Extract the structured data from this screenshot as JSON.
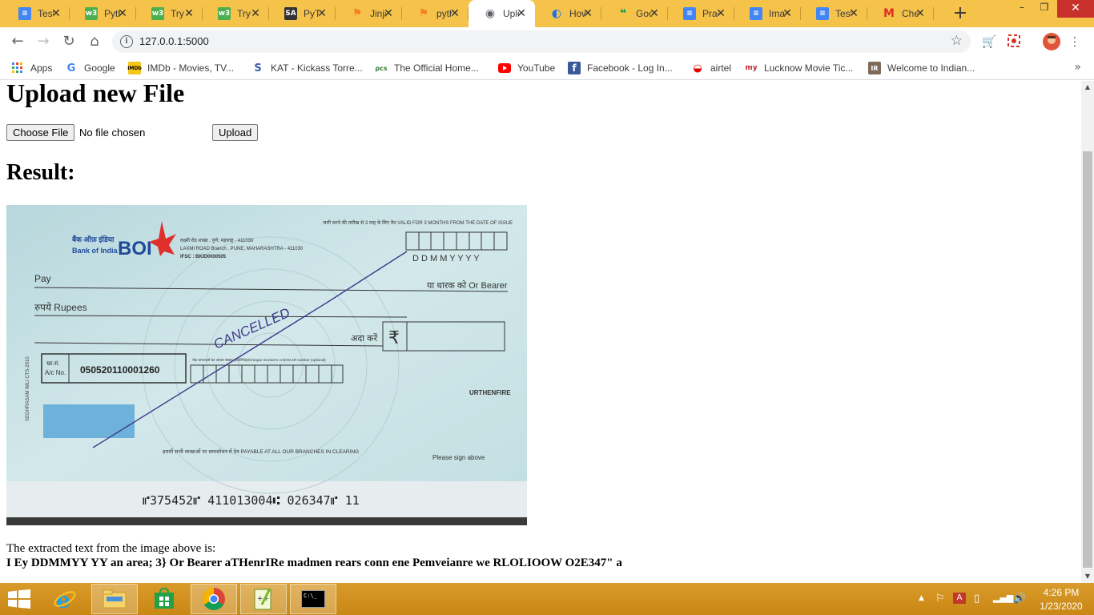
{
  "browser": {
    "tabs": [
      {
        "title": "Test",
        "icon": "docs-icon",
        "color": "#4285f4"
      },
      {
        "title": "Python",
        "icon": "w3schools-icon",
        "color": "#4caf50"
      },
      {
        "title": "Try it",
        "icon": "w3schools-icon",
        "color": "#4caf50"
      },
      {
        "title": "Try it",
        "icon": "w3schools-icon",
        "color": "#4caf50"
      },
      {
        "title": "PyTorch",
        "icon": "sa-icon",
        "color": "#333333"
      },
      {
        "title": "Jinja",
        "icon": "stackoverflow-icon",
        "color": "#f48024"
      },
      {
        "title": "python",
        "icon": "stackoverflow-icon",
        "color": "#f48024"
      },
      {
        "title": "Upload",
        "icon": "globe-icon",
        "color": "#5f6368"
      },
      {
        "title": "How",
        "icon": "chrome-circle-icon",
        "color": "#1a73e8"
      },
      {
        "title": "Google",
        "icon": "hangouts-icon",
        "color": "#0f9d58"
      },
      {
        "title": "Practice",
        "icon": "docs-icon",
        "color": "#4285f4"
      },
      {
        "title": "Image",
        "icon": "docs-icon",
        "color": "#4285f4"
      },
      {
        "title": "Test",
        "icon": "docs-icon",
        "color": "#4285f4"
      },
      {
        "title": "Check",
        "icon": "gmail-icon",
        "color": "#d93025"
      }
    ],
    "active_tab_index": 7,
    "new_tab_label": "+",
    "window_controls": {
      "minimize": "–",
      "restore": "❐",
      "close": "✕"
    },
    "nav": {
      "back": "←",
      "forward": "→",
      "reload": "↻",
      "home": "⌂"
    },
    "url": "127.0.0.1:5000",
    "bookmarks": [
      {
        "label": "Apps",
        "icon": "apps-grid-icon"
      },
      {
        "label": "Google",
        "icon": "google-icon"
      },
      {
        "label": "IMDb - Movies, TV...",
        "icon": "imdb-icon"
      },
      {
        "label": "KAT - Kickass Torre...",
        "icon": "kat-icon"
      },
      {
        "label": "The Official Home...",
        "icon": "official-home-icon"
      },
      {
        "label": "YouTube",
        "icon": "youtube-icon"
      },
      {
        "label": "Facebook - Log In...",
        "icon": "facebook-icon"
      },
      {
        "label": "airtel",
        "icon": "airtel-icon"
      },
      {
        "label": "Lucknow Movie Tic...",
        "icon": "bookmyshow-icon"
      },
      {
        "label": "Welcome to Indian...",
        "icon": "indian-rail-icon"
      }
    ],
    "bookmarks_more": "»"
  },
  "page": {
    "heading": "Upload new File",
    "choose_file_label": "Choose File",
    "file_status": "No file chosen",
    "upload_label": "Upload",
    "result_heading": "Result:",
    "extract_label": "The extracted text from the image above is:",
    "extracted_text": "I Ey DDMMYY YY an area; 3} Or Bearer aTHenrIRe madmen rears conn ene Pemveianre we RLOLIOOW O2E347\" a"
  },
  "cheque": {
    "validity_text": "जारी करने की तारीख से 3 माह के लिए वैध  VALID FOR 3 MONTHS FROM THE DATE OF ISSUE",
    "bank_hindi": "बैंक ऑफ़ इंडिया",
    "bank_english": "Bank of India",
    "bank_logo": "BOI",
    "branch_line1": "लक्ष्मी रोड शाखा , पुणे, महाराष्ट्र - 411030",
    "branch_line2": "LAXMI ROAD Branch , PUNE, MAHARASHTRA - 411030",
    "ifsc": "IFSC : BKID0000505",
    "date_format": "D D M M Y Y Y Y",
    "pay_label": "Pay",
    "bearer_label": "या धारक को  Or Bearer",
    "rupees_label": "रुपये Rupees",
    "amount_label": "अदा करें",
    "rupee_symbol": "₹",
    "cancelled_text": "CANCELLED",
    "account_label_hindi": "खा.सं.",
    "account_label": "A/c No.",
    "account_number": "050520110001260",
    "aadhaar_label": "चेक प्राप्तकर्ता का आधार संख्या (वैकल्पिक)/Cheque receiver's AADHAAR number (optional)",
    "account_holder": "URTHENFIRE",
    "payable_text": "हमारी सभी शाखाओं पर समाशोधन में देय  PAYABLE AT ALL OUR BRANCHES IN CLEARING",
    "sign_label": "Please sign above",
    "micr": "⑈375452⑈ 411013004⑆ 026347⑈ 11",
    "side_text": "SEGHRASAM IMLI CTS-2010"
  },
  "taskbar": {
    "apps": [
      {
        "name": "internet-explorer",
        "icon": "ie-icon"
      },
      {
        "name": "file-explorer",
        "icon": "folder-icon"
      },
      {
        "name": "store",
        "icon": "store-icon"
      },
      {
        "name": "chrome",
        "icon": "chrome-icon"
      },
      {
        "name": "notepad-plus-plus",
        "icon": "notepad-icon"
      },
      {
        "name": "command-prompt",
        "icon": "cmd-icon"
      }
    ],
    "cmd_glyph": "C:\\_",
    "clock_time": "4:26 PM",
    "clock_date": "1/23/2020"
  },
  "colors": {
    "tabstrip": "#f5c24a",
    "taskbar": "#d4951f",
    "cheque_bg": "#c9e2e4"
  }
}
